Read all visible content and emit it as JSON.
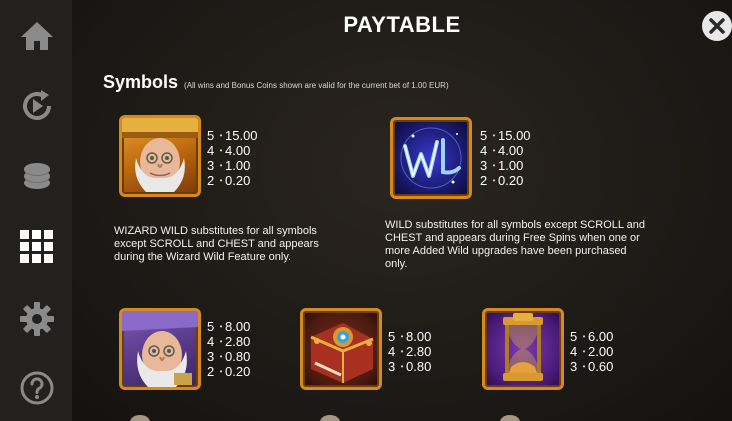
{
  "header": {
    "title": "PAYTABLE"
  },
  "sidebar": {
    "items": [
      {
        "icon": "home-icon"
      },
      {
        "icon": "autoplay-icon"
      },
      {
        "icon": "coins-icon"
      },
      {
        "icon": "paytable-grid-icon"
      },
      {
        "icon": "gear-icon"
      },
      {
        "icon": "help-icon"
      }
    ]
  },
  "close": {
    "icon": "close-icon"
  },
  "symbols_section": {
    "heading": "Symbols",
    "note": "(All wins and Bonus Coins shown are valid for the current bet of 1.00 EUR)"
  },
  "symbols": [
    {
      "name": "wizard-wild",
      "pays": [
        {
          "count": "5",
          "value": "15.00"
        },
        {
          "count": "4",
          "value": "4.00"
        },
        {
          "count": "3",
          "value": "1.00"
        },
        {
          "count": "2",
          "value": "0.20"
        }
      ],
      "description": "WIZARD WILD substitutes for all symbols except SCROLL and CHEST and appears during the Wizard Wild Feature only."
    },
    {
      "name": "wild",
      "pays": [
        {
          "count": "5",
          "value": "15.00"
        },
        {
          "count": "4",
          "value": "4.00"
        },
        {
          "count": "3",
          "value": "1.00"
        },
        {
          "count": "2",
          "value": "0.20"
        }
      ],
      "description": "WILD substitutes for all symbols except SCROLL and CHEST and appears during Free Spins when one or more Added Wild upgrades have been purchased only."
    },
    {
      "name": "wizard",
      "pays": [
        {
          "count": "5",
          "value": "8.00"
        },
        {
          "count": "4",
          "value": "2.80"
        },
        {
          "count": "3",
          "value": "0.80"
        },
        {
          "count": "2",
          "value": "0.20"
        }
      ]
    },
    {
      "name": "spellbook",
      "pays": [
        {
          "count": "5",
          "value": "8.00"
        },
        {
          "count": "4",
          "value": "2.80"
        },
        {
          "count": "3",
          "value": "0.80"
        }
      ]
    },
    {
      "name": "hourglass",
      "pays": [
        {
          "count": "5",
          "value": "6.00"
        },
        {
          "count": "4",
          "value": "2.00"
        },
        {
          "count": "3",
          "value": "0.60"
        }
      ]
    }
  ],
  "colors": {
    "frame": "#d68a1e",
    "sidebar_bg": "#232120",
    "icon": "#8a8a8a"
  }
}
